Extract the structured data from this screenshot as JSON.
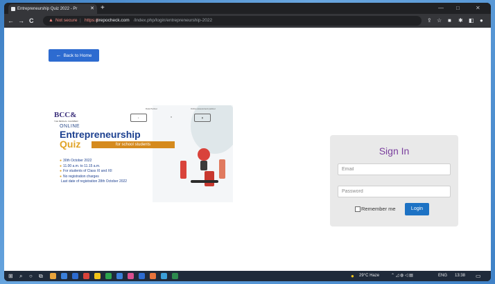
{
  "browser": {
    "tab_title": "Entrepreneurship Quiz 2022 - Pr",
    "tab_close": "✕",
    "new_tab": "+",
    "minimize": "—",
    "maximize": "□",
    "close": "✕",
    "back": "←",
    "forward": "→",
    "reload": "C",
    "not_secure": "Not secure",
    "url_scheme": "https://",
    "url_host": "prepocheck.com",
    "url_path": "/index.php/login/entrepreneurship-2022"
  },
  "page": {
    "back_button_label": "Back to Home",
    "back_arrow": "←"
  },
  "banner": {
    "org": "BCC&",
    "org_sub": "THE BENGAL CHAMBER",
    "label_partner": "Data Partner",
    "label_assessment": "Online assessment partner",
    "online": "ONLINE",
    "title": "Entrepreneurship",
    "quiz": "Quiz",
    "subtitle": "for school students",
    "details": [
      "30th October 2022",
      "11.00 a.m. to 11.15 a.m.",
      "For students of Class XI and XII",
      "No registration charges",
      "Last date of registration 28th October 2022"
    ]
  },
  "signin": {
    "title": "Sign In",
    "email_placeholder": "Email",
    "password_placeholder": "Password",
    "remember_label": "Remember me",
    "login_label": "Login"
  },
  "taskbar": {
    "weather": "29°C Haze",
    "lang": "ENG",
    "time": "13:38"
  },
  "colors": {
    "accent_blue": "#2d6bd0",
    "signin_purple": "#7a3e9d",
    "login_blue": "#1d72c4"
  }
}
